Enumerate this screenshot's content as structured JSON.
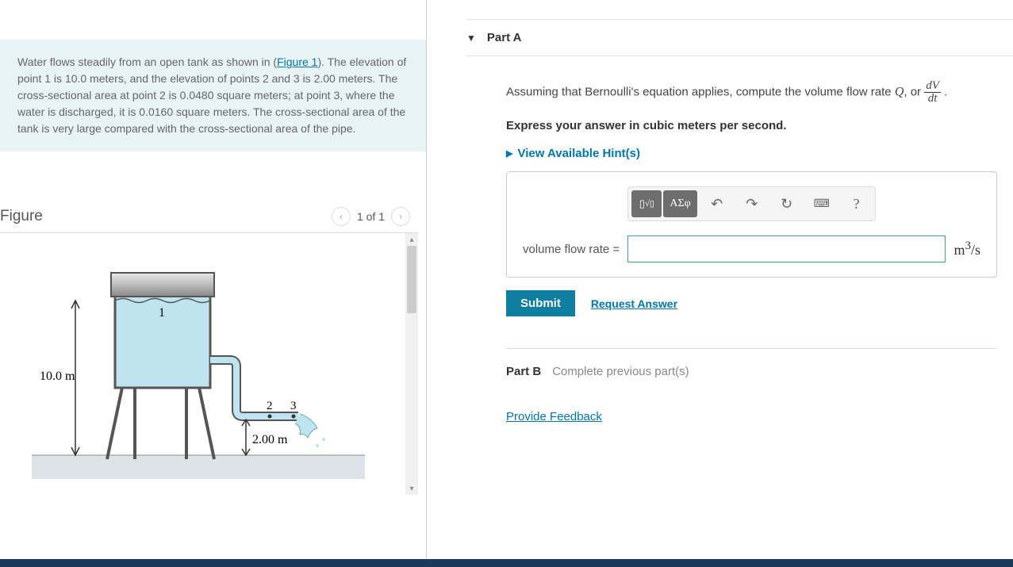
{
  "problem": {
    "text_before_link": "Water flows steadily from an open tank as shown in (",
    "link_text": "Figure 1",
    "text_after_link": "). The elevation of point 1 is 10.0 meters, and the elevation of points 2 and 3 is 2.00 meters. The cross-sectional area at point 2 is 0.0480 square meters; at point 3, where the water is discharged, it is 0.0160 square meters. The cross-sectional area of the tank is very large compared with the cross-sectional area of the pipe."
  },
  "figure": {
    "title": "Figure",
    "nav_count": "1 of 1",
    "label_height": "10.0 m",
    "label_pipe_height": "2.00 m",
    "point1": "1",
    "point2": "2",
    "point3": "3"
  },
  "partA": {
    "label": "Part A",
    "question_before": "Assuming that Bernoulli's equation applies, compute the volume flow rate ",
    "question_var": "Q",
    "question_mid": ", or ",
    "frac_num": "dV",
    "frac_den": "dt",
    "question_after": " .",
    "instruction": "Express your answer in cubic meters per second.",
    "hints": "View Available Hint(s)",
    "toolbar": {
      "templates": "▮√▮",
      "greek": "ΑΣφ"
    },
    "answer_label": "volume flow rate =",
    "answer_value": "",
    "unit_html": "m³/s",
    "submit": "Submit",
    "request": "Request Answer"
  },
  "partB": {
    "label": "Part B",
    "text": "Complete previous part(s)"
  },
  "feedback": "Provide Feedback",
  "chart_data": {
    "type": "diagram",
    "description": "Open tank on legs with outlet pipe",
    "elevation_point1_m": 10.0,
    "elevation_points_2_3_m": 2.0,
    "area_point2_m2": 0.048,
    "area_point3_m2": 0.016,
    "points": [
      1,
      2,
      3
    ]
  }
}
